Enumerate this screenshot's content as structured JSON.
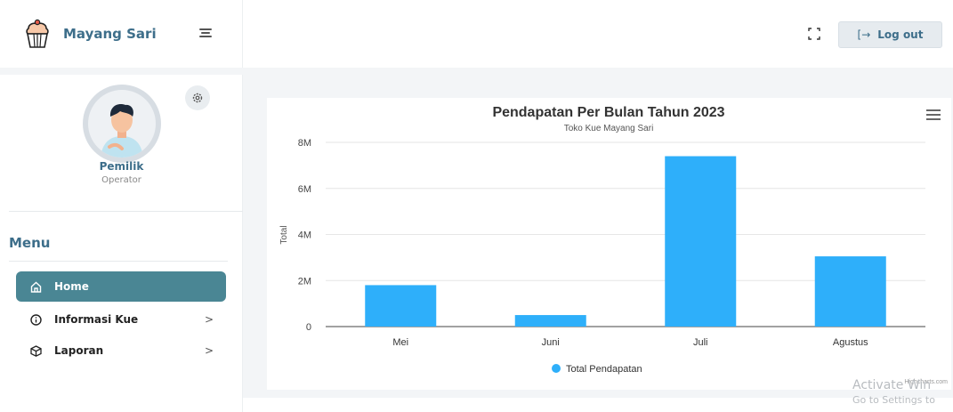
{
  "brand": {
    "name": "Mayang Sari"
  },
  "profile": {
    "name": "Pemilik",
    "role": "Operator"
  },
  "menu": {
    "title": "Menu",
    "items": [
      {
        "label": "Home",
        "icon": "home-icon",
        "active": true,
        "has_arrow": false
      },
      {
        "label": "Informasi Kue",
        "icon": "info-icon",
        "active": false,
        "has_arrow": true
      },
      {
        "label": "Laporan",
        "icon": "cube-icon",
        "active": false,
        "has_arrow": true
      }
    ],
    "arrow": ">"
  },
  "header": {
    "logout_label": "Log out",
    "logout_icon": "[→"
  },
  "colors": {
    "accent": "#4a8694",
    "brand_text": "#3d6e8a",
    "bar": "#2eaffa"
  },
  "chart_data": {
    "type": "bar",
    "title": "Pendapatan Per Bulan Tahun 2023",
    "subtitle": "Toko Kue Mayang Sari",
    "ylabel": "Total",
    "xlabel": "",
    "categories": [
      "Mei",
      "Juni",
      "Juli",
      "Agustus"
    ],
    "series": [
      {
        "name": "Total Pendapatan",
        "values": [
          1800000,
          500000,
          7400000,
          3050000
        ]
      }
    ],
    "ylim": [
      0,
      8000000
    ],
    "yticks": [
      0,
      2000000,
      4000000,
      6000000,
      8000000
    ],
    "ytick_labels": [
      "0",
      "2M",
      "4M",
      "6M",
      "8M"
    ],
    "grid": true,
    "legend": "bottom-center",
    "credits": "Highcharts.com"
  },
  "watermark": {
    "line1": "Activate Win",
    "line2": "Go to Settings to"
  }
}
